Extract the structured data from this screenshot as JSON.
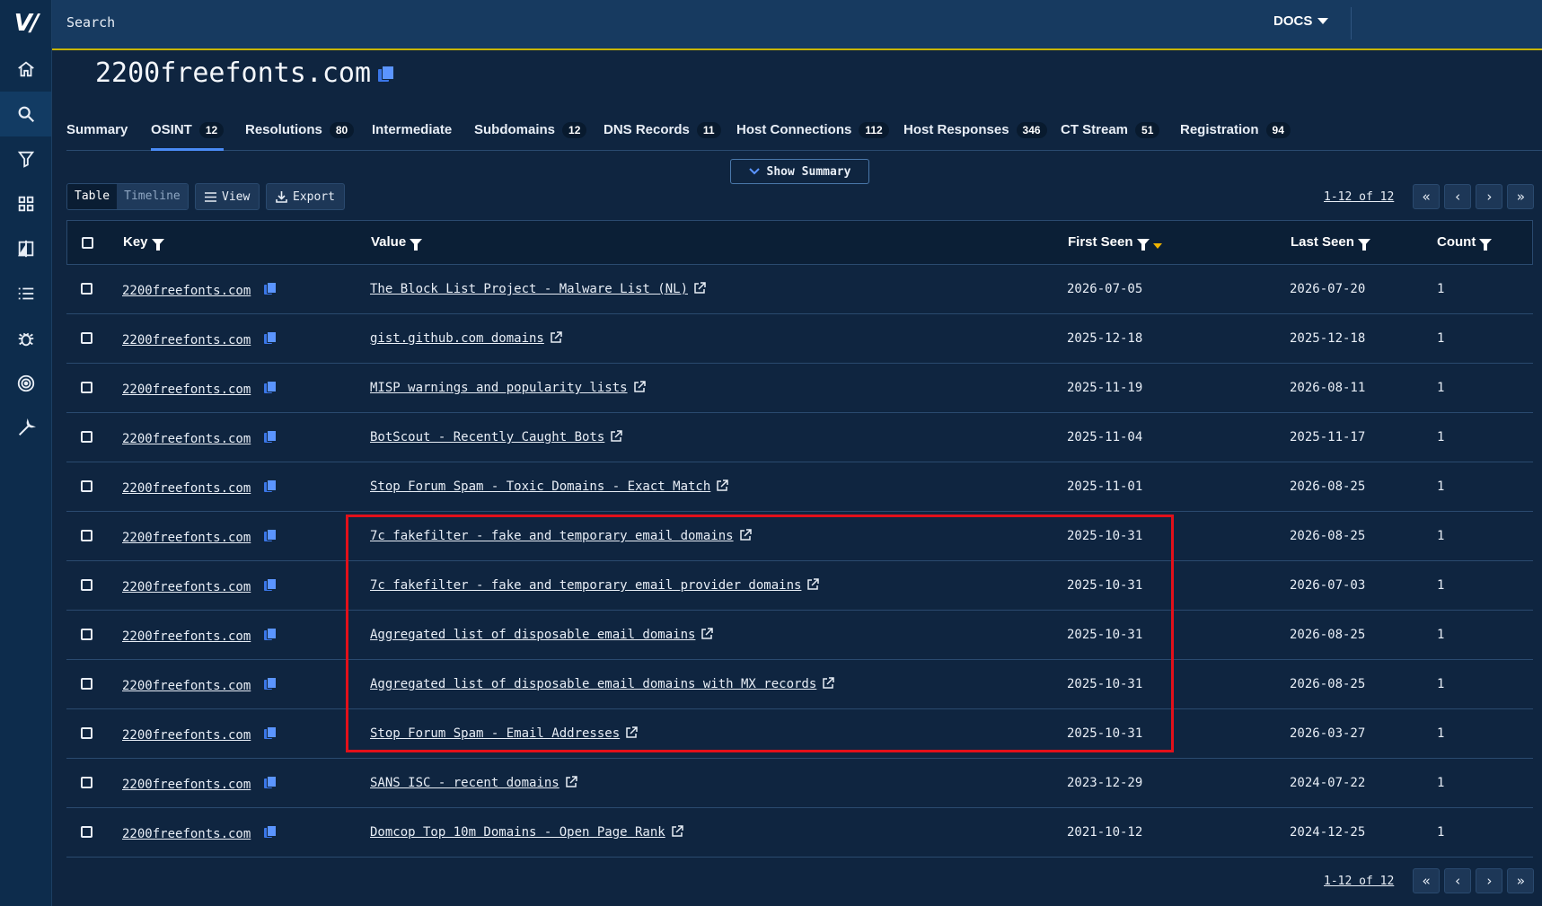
{
  "brand": {
    "logo": "V/"
  },
  "sidebar": {
    "items": [
      {
        "icon": "home-icon"
      },
      {
        "icon": "search-icon"
      },
      {
        "icon": "filter-icon"
      },
      {
        "icon": "grid-icon"
      },
      {
        "icon": "compare-icon"
      },
      {
        "icon": "list-icon"
      },
      {
        "icon": "bug-icon"
      },
      {
        "icon": "target-icon"
      },
      {
        "icon": "wrench-icon"
      }
    ]
  },
  "topbar": {
    "search_label": "Search",
    "docs_label": "DOCS"
  },
  "page": {
    "title": "2200freefonts.com"
  },
  "tabs": [
    {
      "label": "Summary",
      "count": ""
    },
    {
      "label": "OSINT",
      "count": "12"
    },
    {
      "label": "Resolutions",
      "count": "80"
    },
    {
      "label": "Intermediate",
      "count": ""
    },
    {
      "label": "Subdomains",
      "count": "12"
    },
    {
      "label": "DNS Records",
      "count": "11"
    },
    {
      "label": "Host Connections",
      "count": "112"
    },
    {
      "label": "Host Responses",
      "count": "346"
    },
    {
      "label": "CT Stream",
      "count": "51"
    },
    {
      "label": "Registration",
      "count": "94"
    }
  ],
  "summary_toggle": "Show Summary",
  "toolbar": {
    "table": "Table",
    "timeline": "Timeline",
    "view": "View",
    "export": "Export"
  },
  "pagination": {
    "range": "1-12 of 12"
  },
  "table": {
    "headers": {
      "key": "Key",
      "value": "Value",
      "first_seen": "First Seen",
      "last_seen": "Last Seen",
      "count": "Count"
    },
    "rows": [
      {
        "key": "2200freefonts.com",
        "value": "The Block List Project - Malware List (NL)",
        "first": "2026-07-05",
        "last": "2026-07-20",
        "count": "1"
      },
      {
        "key": "2200freefonts.com",
        "value": "gist.github.com domains",
        "first": "2025-12-18",
        "last": "2025-12-18",
        "count": "1"
      },
      {
        "key": "2200freefonts.com",
        "value": "MISP warnings and popularity lists",
        "first": "2025-11-19",
        "last": "2026-08-11",
        "count": "1"
      },
      {
        "key": "2200freefonts.com",
        "value": "BotScout - Recently Caught Bots",
        "first": "2025-11-04",
        "last": "2025-11-17",
        "count": "1"
      },
      {
        "key": "2200freefonts.com",
        "value": "Stop Forum Spam - Toxic Domains - Exact Match",
        "first": "2025-11-01",
        "last": "2026-08-25",
        "count": "1"
      },
      {
        "key": "2200freefonts.com",
        "value": "7c fakefilter - fake and temporary email domains",
        "first": "2025-10-31",
        "last": "2026-08-25",
        "count": "1"
      },
      {
        "key": "2200freefonts.com",
        "value": "7c fakefilter - fake and temporary email provider domains",
        "first": "2025-10-31",
        "last": "2026-07-03",
        "count": "1"
      },
      {
        "key": "2200freefonts.com",
        "value": "Aggregated list of disposable email domains",
        "first": "2025-10-31",
        "last": "2026-08-25",
        "count": "1"
      },
      {
        "key": "2200freefonts.com",
        "value": "Aggregated list of disposable email domains with MX records",
        "first": "2025-10-31",
        "last": "2026-08-25",
        "count": "1"
      },
      {
        "key": "2200freefonts.com",
        "value": "Stop Forum Spam - Email Addresses",
        "first": "2025-10-31",
        "last": "2026-03-27",
        "count": "1"
      },
      {
        "key": "2200freefonts.com",
        "value": "SANS ISC - recent domains",
        "first": "2023-12-29",
        "last": "2024-07-22",
        "count": "1"
      },
      {
        "key": "2200freefonts.com",
        "value": "Domcop Top 10m Domains - Open Page Rank",
        "first": "2021-10-12",
        "last": "2024-12-25",
        "count": "1"
      }
    ]
  },
  "colors": {
    "highlight": "#e2101a",
    "accent": "#4a8bf5",
    "sort": "#f0b400"
  }
}
